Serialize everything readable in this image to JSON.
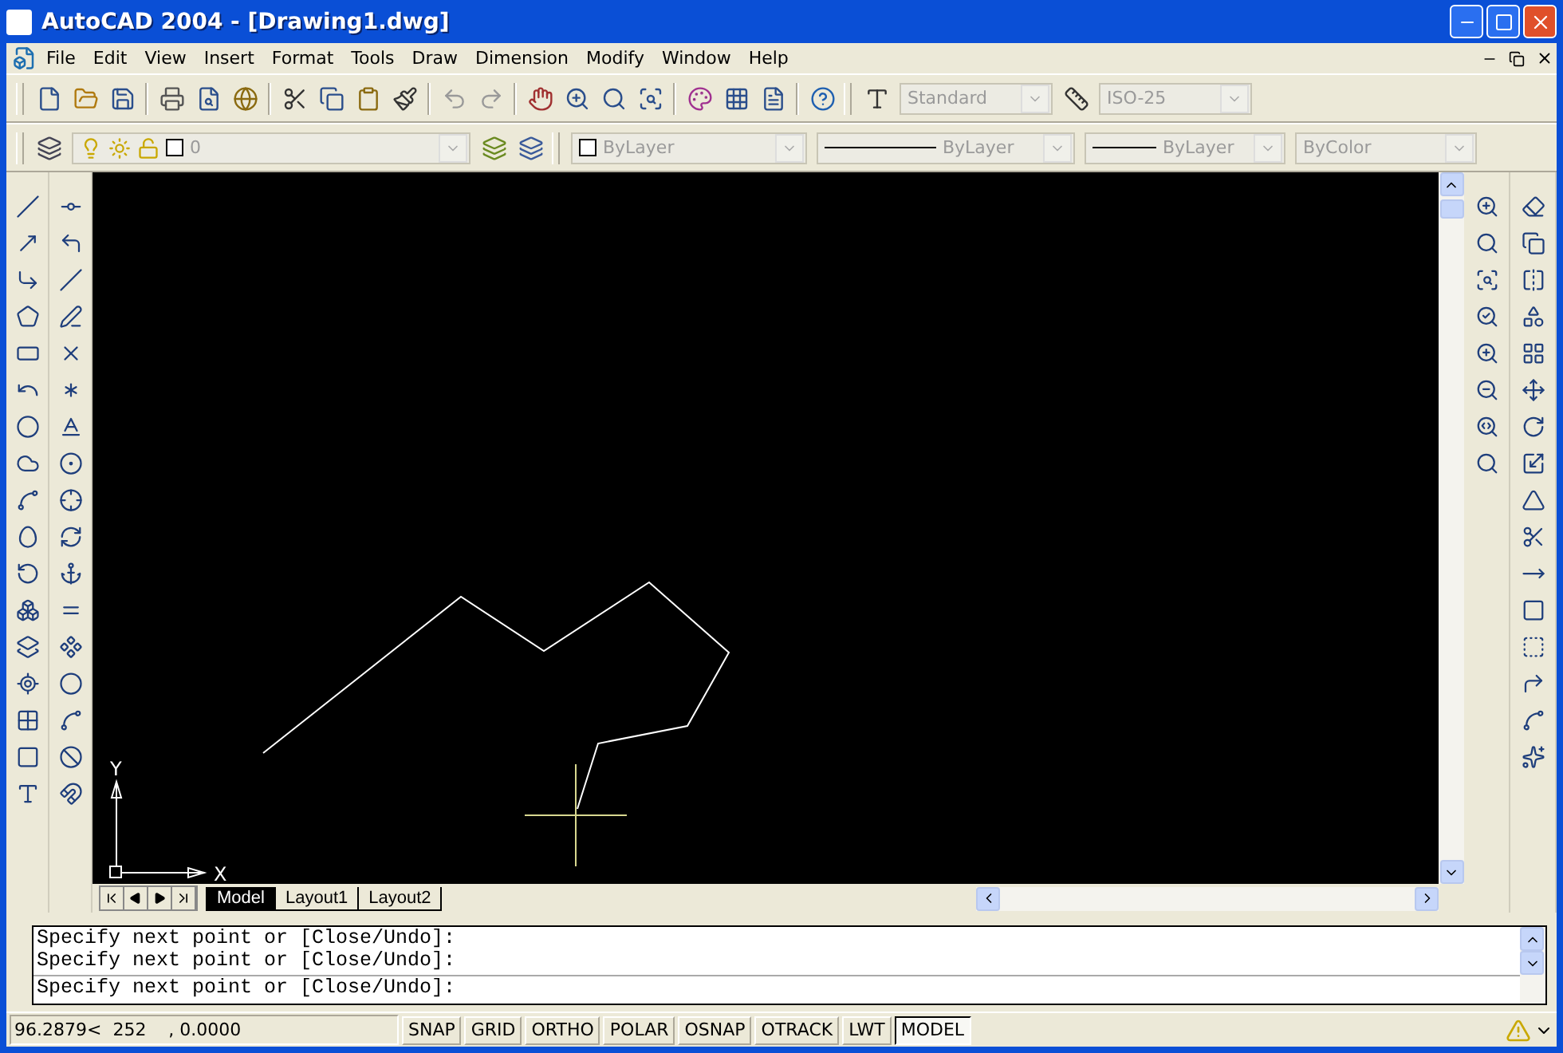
{
  "window": {
    "title": "AutoCAD 2004 - [Drawing1.dwg]"
  },
  "menu": [
    "File",
    "Edit",
    "View",
    "Insert",
    "Format",
    "Tools",
    "Draw",
    "Dimension",
    "Modify",
    "Window",
    "Help"
  ],
  "styles_toolbar": {
    "text_style": "Standard",
    "dim_style": "ISO-25"
  },
  "properties_toolbar": {
    "layer": "0",
    "color_control": "ByLayer",
    "linetype": "ByLayer",
    "lineweight": "ByLayer",
    "plot_style": "ByColor"
  },
  "ucs": {
    "y_label": "Y",
    "x_label": "X"
  },
  "layout_tabs": [
    {
      "label": "Model",
      "selected": true
    },
    {
      "label": "Layout1",
      "selected": false
    },
    {
      "label": "Layout2",
      "selected": false
    }
  ],
  "command_history": [
    "Specify next point or [Close/Undo]:",
    "Specify next point or [Close/Undo]:"
  ],
  "command_prompt": "Specify next point or [Close/Undo]:",
  "status_bar": {
    "coordinates": "96.2879<  252    , 0.0000",
    "toggles": [
      {
        "label": "SNAP",
        "on": false
      },
      {
        "label": "GRID",
        "on": false
      },
      {
        "label": "ORTHO",
        "on": false
      },
      {
        "label": "POLAR",
        "on": false
      },
      {
        "label": "OSNAP",
        "on": false
      },
      {
        "label": "OTRACK",
        "on": false
      },
      {
        "label": "LWT",
        "on": false
      },
      {
        "label": "MODEL",
        "on": true
      }
    ]
  }
}
